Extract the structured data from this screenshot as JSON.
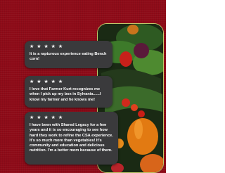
{
  "colors": {
    "background": "#8e0b18",
    "card": "#3a3a3c",
    "card_text": "#ffffff",
    "phone_frame": "#bfc96a"
  },
  "testimonials": [
    {
      "rating": 5,
      "stars": "★ ★ ★ ★ ★",
      "quote": "It is a rapturous experience eating Bench corn!"
    },
    {
      "rating": 5,
      "stars": "★ ★ ★ ★ ★",
      "quote": "I love that Farmer Kurt recognizes me when I pick up my box in Sylvania......I know my farmer and he knows me!"
    },
    {
      "rating": 5,
      "stars": "★ ★ ★ ★ ★",
      "quote": "I have been with Shared Legacy for a few years and it is so encouraging to see how hard they work to refine the CSA experience. It's so much more than vegetables! It's community and education and delicious nutrition. I'm a better mom because of them."
    }
  ],
  "phone": {
    "image": "vegetables-photo"
  }
}
